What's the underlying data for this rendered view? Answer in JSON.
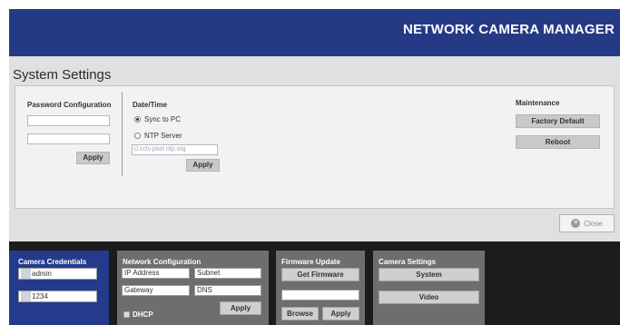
{
  "header": {
    "title": "NETWORK CAMERA MANAGER"
  },
  "settings": {
    "title": "System Settings",
    "password": {
      "title": "Password Configuration",
      "field1_value": "",
      "field2_value": "",
      "apply_label": "Apply"
    },
    "datetime": {
      "title": "Date/Time",
      "sync_label": "Sync to PC",
      "sync_selected": true,
      "ntp_label": "NTP Server",
      "ntp_selected": false,
      "ntp_placeholder": "0.cctv.pool.ntp.org",
      "apply_label": "Apply"
    },
    "maintenance": {
      "title": "Maintenance",
      "factory_label": "Factory Default",
      "reboot_label": "Reboot"
    },
    "close_label": "Close"
  },
  "bottom": {
    "credentials": {
      "title": "Camera Credentials",
      "username": "admin",
      "password": "1234"
    },
    "network": {
      "title": "Network Configuration",
      "ip_placeholder": "IP Address",
      "subnet_placeholder": "Subnet",
      "gateway_placeholder": "Gateway",
      "dns_placeholder": "DNS",
      "dhcp_label": "DHCP",
      "apply_label": "Apply"
    },
    "firmware": {
      "title": "Firmware Update",
      "get_label": "Get Firmware",
      "file_value": "",
      "browse_label": "Browse",
      "apply_label": "Apply"
    },
    "camera_settings": {
      "title": "Camera Settings",
      "system_label": "System",
      "video_label": "Video"
    }
  },
  "colors": {
    "header_bg": "#253a84",
    "credentials_bg": "#243b8c",
    "panel_grey": "#6e6e6e",
    "bottom_bg": "#1c1c1c"
  }
}
